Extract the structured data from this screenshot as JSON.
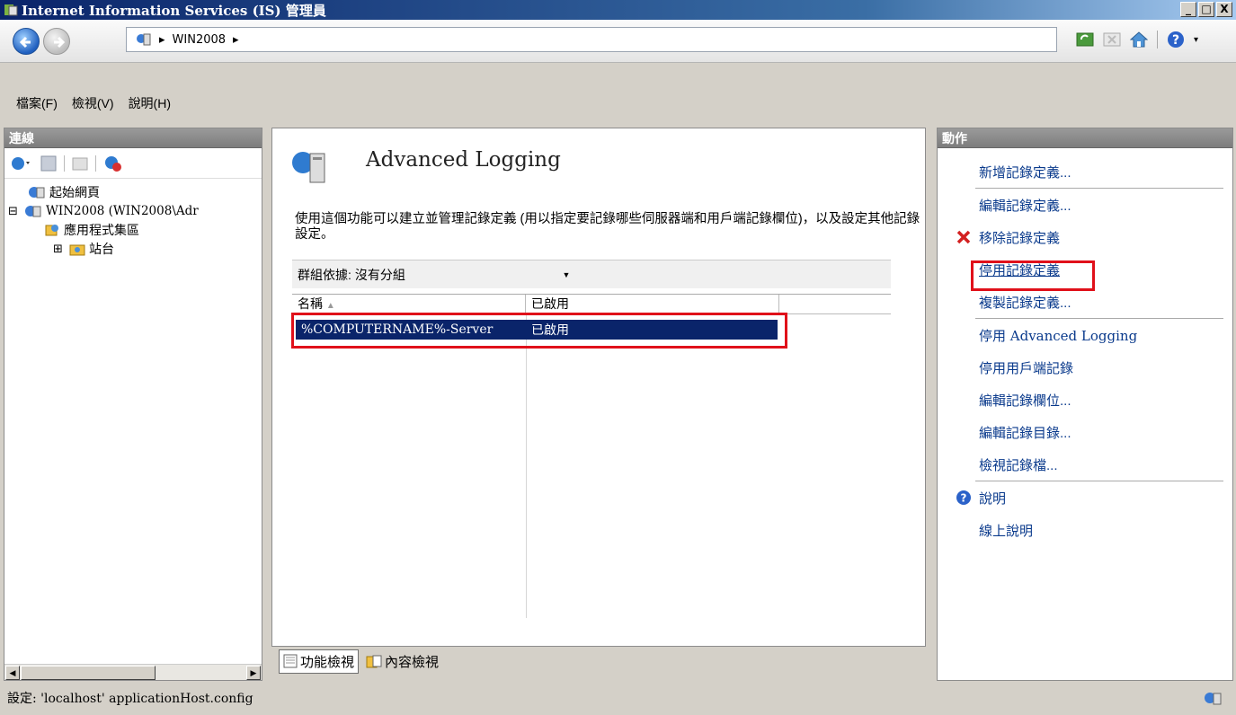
{
  "window": {
    "title": "Internet Information Services (IS) 管理員",
    "controls": [
      "_",
      "□",
      "X"
    ]
  },
  "address": {
    "crumb": "WIN2008",
    "sep": "▸"
  },
  "menu": {
    "items": [
      "檔案(F)",
      "檢視(V)",
      "說明(H)"
    ]
  },
  "connections": {
    "title": "連線",
    "tree": [
      {
        "label": "起始網頁",
        "expander": ""
      },
      {
        "label": "WIN2008 (WIN2008\\Adr",
        "expander": "⊟"
      },
      {
        "label": "應用程式集區",
        "expander": ""
      },
      {
        "label": "站台",
        "expander": "⊞"
      }
    ]
  },
  "feature": {
    "title": "Advanced Logging",
    "description": "使用這個功能可以建立並管理記錄定義 (用以指定要記錄哪些伺服器端和用戶端記錄欄位)，以及設定其他記錄設定。",
    "group_label": "群組依據:",
    "group_value": "沒有分組",
    "columns": [
      "名稱",
      "已啟用"
    ],
    "rows": [
      {
        "name": "%COMPUTERNAME%-Server",
        "enabled": "已啟用"
      }
    ]
  },
  "view_tabs": {
    "features": "功能檢視",
    "content": "內容檢視"
  },
  "actions": {
    "title": "動作",
    "group1": [
      "新增記錄定義..."
    ],
    "group2": [
      "編輯記錄定義...",
      "移除記錄定義",
      "停用記錄定義",
      "複製記錄定義..."
    ],
    "group3": [
      "停用 Advanced Logging",
      "停用用戶端記錄",
      "編輯記錄欄位...",
      "編輯記錄目錄...",
      "檢視記錄檔..."
    ],
    "group4": [
      "說明",
      "線上說明"
    ]
  },
  "status": {
    "text": "設定: 'localhost' applicationHost.config"
  },
  "colors": {
    "selection": "#0a246a",
    "highlight_box": "#e0101a",
    "link": "#0a3a8c"
  }
}
